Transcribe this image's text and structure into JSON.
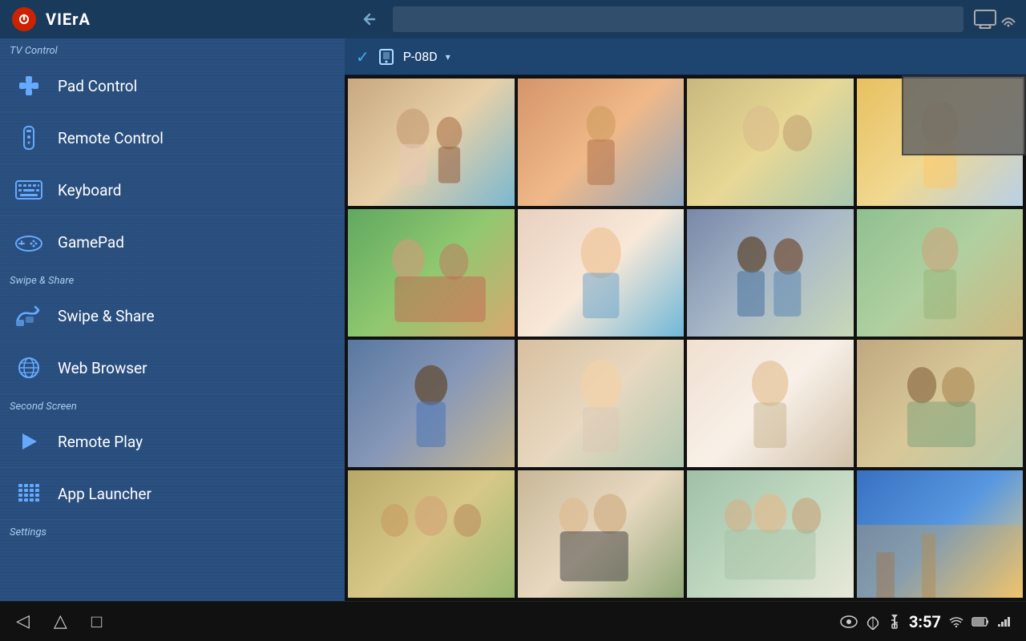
{
  "app": {
    "title": "VIErA",
    "time": "3:57"
  },
  "sidebar": {
    "sections": [
      {
        "label": "TV Control",
        "items": [
          {
            "id": "pad-control",
            "label": "Pad Control",
            "icon": "gamepad-cross-icon"
          },
          {
            "id": "remote-control",
            "label": "Remote Control",
            "icon": "remote-icon"
          },
          {
            "id": "keyboard",
            "label": "Keyboard",
            "icon": "keyboard-icon"
          },
          {
            "id": "gamepad",
            "label": "GamePad",
            "icon": "controller-icon"
          }
        ]
      },
      {
        "label": "Swipe & Share",
        "items": [
          {
            "id": "swipe-share",
            "label": "Swipe & Share",
            "icon": "swipe-icon"
          },
          {
            "id": "web-browser",
            "label": "Web Browser",
            "icon": "globe-icon"
          }
        ]
      },
      {
        "label": "Second Screen",
        "items": [
          {
            "id": "remote-play",
            "label": "Remote Play",
            "icon": "play-icon"
          },
          {
            "id": "app-launcher",
            "label": "App Launcher",
            "icon": "grid-icon"
          }
        ]
      },
      {
        "label": "Settings",
        "items": []
      }
    ]
  },
  "content": {
    "device_name": "P-08D",
    "check_label": "✓",
    "photos": [
      {
        "id": 1,
        "class": "photo-1"
      },
      {
        "id": 2,
        "class": "photo-2"
      },
      {
        "id": 3,
        "class": "photo-3"
      },
      {
        "id": 4,
        "class": "photo-4"
      },
      {
        "id": 5,
        "class": "photo-5"
      },
      {
        "id": 6,
        "class": "photo-6"
      },
      {
        "id": 7,
        "class": "photo-7"
      },
      {
        "id": 8,
        "class": "photo-8"
      },
      {
        "id": 9,
        "class": "photo-9"
      },
      {
        "id": 10,
        "class": "photo-10"
      },
      {
        "id": 11,
        "class": "photo-11"
      },
      {
        "id": 12,
        "class": "photo-12"
      },
      {
        "id": 13,
        "class": "photo-13"
      },
      {
        "id": 14,
        "class": "photo-14"
      },
      {
        "id": 15,
        "class": "photo-15"
      },
      {
        "id": 16,
        "class": "photo-16"
      }
    ]
  },
  "status_bar": {
    "back_nav": "◁",
    "home_nav": "△",
    "recents_nav": "□",
    "time": "3:57"
  }
}
